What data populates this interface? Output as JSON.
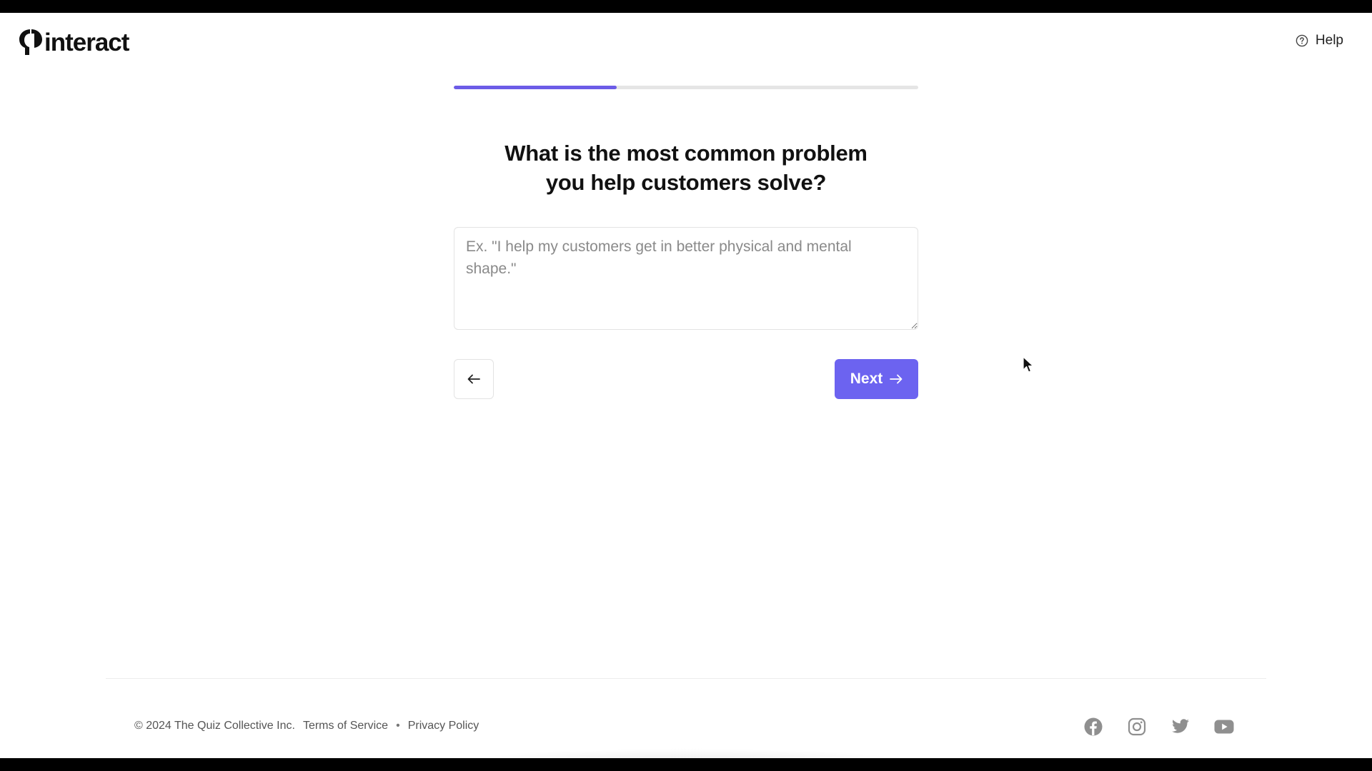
{
  "header": {
    "brand": "interact",
    "help_label": "Help"
  },
  "progress": {
    "fraction": 0.35,
    "fill_color": "#6c5ce7"
  },
  "question": {
    "line1": "What is the most common problem",
    "line2": "you help customers solve?"
  },
  "answer": {
    "value": "",
    "placeholder": "Ex. \"I help my customers get in better physical and mental shape.\""
  },
  "nav": {
    "back_icon": "arrow-left-icon",
    "next_label": "Next",
    "next_icon": "arrow-right-icon",
    "accent_color": "#6c63f0"
  },
  "footer": {
    "copyright": "© 2024 The Quiz Collective Inc.",
    "terms": "Terms of Service",
    "separator": "•",
    "privacy": "Privacy Policy",
    "socials": [
      "facebook-icon",
      "instagram-icon",
      "twitter-icon",
      "youtube-icon"
    ]
  }
}
